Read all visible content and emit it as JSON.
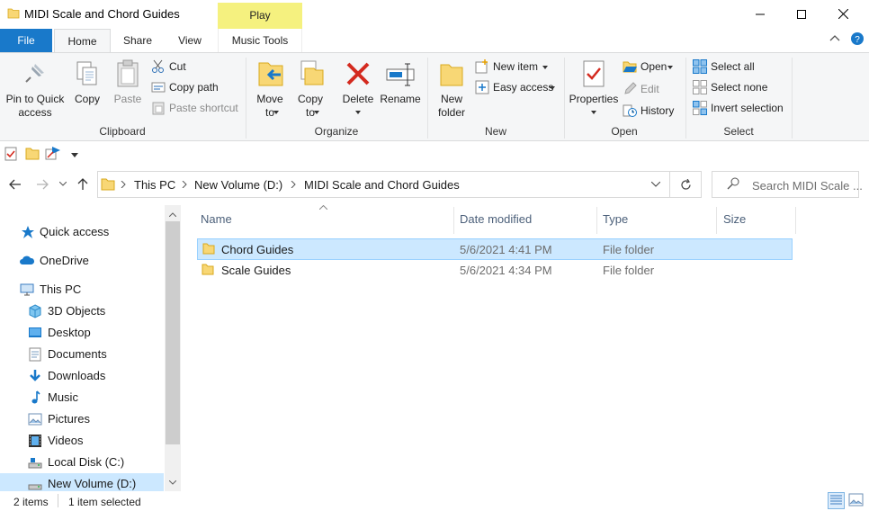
{
  "window": {
    "title": "MIDI Scale and Chord Guides",
    "context_tab_group": "Play",
    "minimize": "minimize",
    "maximize": "maximize",
    "close": "close"
  },
  "tabs": [
    {
      "label": "File"
    },
    {
      "label": "Home"
    },
    {
      "label": "Share"
    },
    {
      "label": "View"
    },
    {
      "label": "Music Tools"
    }
  ],
  "ribbon": {
    "clipboard": {
      "pin_line1": "Pin to Quick",
      "pin_line2": "access",
      "copy": "Copy",
      "paste": "Paste",
      "cut": "Cut",
      "copy_path": "Copy path",
      "paste_shortcut": "Paste shortcut",
      "group": "Clipboard"
    },
    "organize": {
      "move_line1": "Move",
      "move_line2": "to",
      "copy_line1": "Copy",
      "copy_line2": "to",
      "delete": "Delete",
      "rename": "Rename",
      "group": "Organize"
    },
    "new": {
      "folder_line1": "New",
      "folder_line2": "folder",
      "new_item": "New item",
      "easy_access": "Easy access",
      "group": "New"
    },
    "open": {
      "properties": "Properties",
      "open": "Open",
      "edit": "Edit",
      "history": "History",
      "group": "Open"
    },
    "select": {
      "select_all": "Select all",
      "select_none": "Select none",
      "invert": "Invert selection",
      "group": "Select"
    }
  },
  "address": {
    "crumbs": [
      "This PC",
      "New Volume (D:)",
      "MIDI Scale and Chord Guides"
    ],
    "search_placeholder": "Search MIDI Scale ..."
  },
  "nav": {
    "items": [
      {
        "label": "Quick access",
        "icon": "star-icon"
      },
      {
        "label": "OneDrive",
        "icon": "cloud-icon"
      },
      {
        "label": "This PC",
        "icon": "computer-icon"
      },
      {
        "label": "3D Objects",
        "icon": "cube-icon"
      },
      {
        "label": "Desktop",
        "icon": "desktop-icon"
      },
      {
        "label": "Documents",
        "icon": "documents-icon"
      },
      {
        "label": "Downloads",
        "icon": "download-icon"
      },
      {
        "label": "Music",
        "icon": "music-icon"
      },
      {
        "label": "Pictures",
        "icon": "pictures-icon"
      },
      {
        "label": "Videos",
        "icon": "videos-icon"
      },
      {
        "label": "Local Disk (C:)",
        "icon": "drive-icon"
      },
      {
        "label": "New Volume (D:)",
        "icon": "drive-icon"
      }
    ]
  },
  "columns": [
    "Name",
    "Date modified",
    "Type",
    "Size"
  ],
  "files": [
    {
      "name": "Chord Guides",
      "date": "5/6/2021 4:41 PM",
      "type": "File folder",
      "selected": true
    },
    {
      "name": "Scale Guides",
      "date": "5/6/2021 4:34 PM",
      "type": "File folder",
      "selected": false
    }
  ],
  "status": {
    "count": "2 items",
    "selected": "1 item selected"
  },
  "colors": {
    "accent": "#1979ca",
    "selection": "#cce8ff",
    "context_tab": "#f5f17f",
    "folder": "#f8d775"
  }
}
